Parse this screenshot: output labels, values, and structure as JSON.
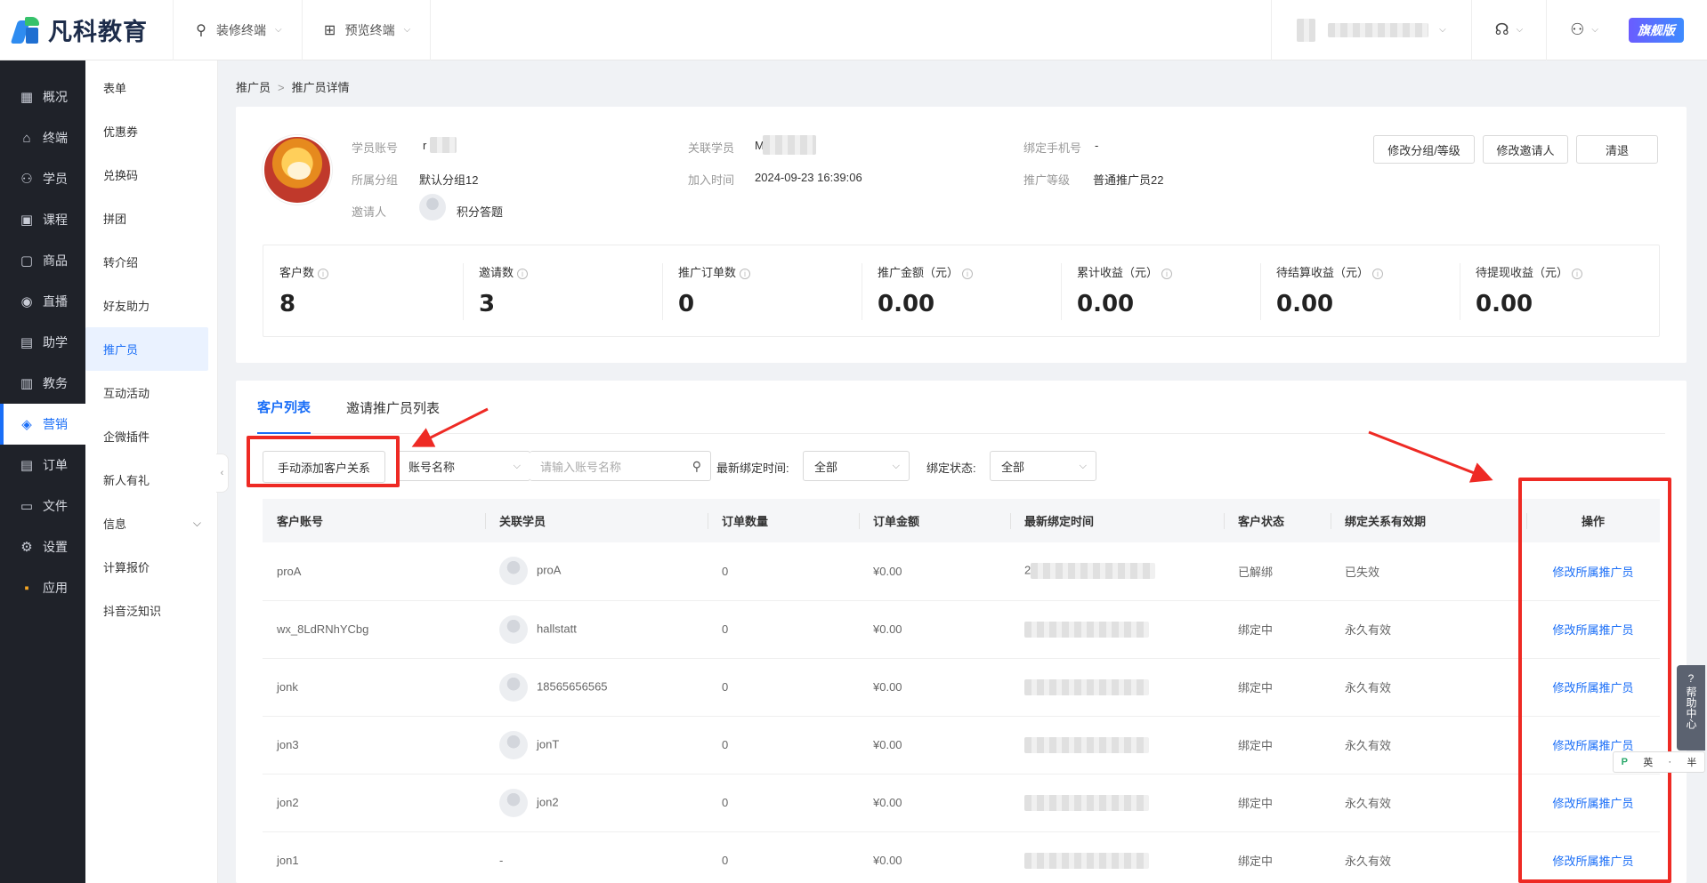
{
  "brand": {
    "name": "凡科教育"
  },
  "top_menu": [
    {
      "label": "装修终端",
      "icon": "brush-icon"
    },
    {
      "label": "预览终端",
      "icon": "grid-icon"
    }
  ],
  "top_right": {
    "edition_badge": "旗舰版"
  },
  "nav_primary": [
    {
      "label": "概况",
      "icon": "dashboard-icon"
    },
    {
      "label": "终端",
      "icon": "store-icon"
    },
    {
      "label": "学员",
      "icon": "user-icon"
    },
    {
      "label": "课程",
      "icon": "course-icon"
    },
    {
      "label": "商品",
      "icon": "bag-icon"
    },
    {
      "label": "直播",
      "icon": "live-icon"
    },
    {
      "label": "助学",
      "icon": "assist-icon"
    },
    {
      "label": "教务",
      "icon": "book-icon"
    },
    {
      "label": "营销",
      "icon": "marketing-icon",
      "active": true
    },
    {
      "label": "订单",
      "icon": "order-icon"
    },
    {
      "label": "文件",
      "icon": "folder-icon"
    },
    {
      "label": "设置",
      "icon": "gear-icon"
    },
    {
      "label": "应用",
      "icon": "apps-icon"
    }
  ],
  "nav_secondary": [
    "表单",
    "优惠券",
    "兑换码",
    "拼团",
    "转介绍",
    "好友助力",
    "推广员",
    "互动活动",
    "企微插件",
    "新人有礼",
    "信息",
    "计算报价",
    "抖音泛知识"
  ],
  "nav_secondary_active": "推广员",
  "breadcrumb": {
    "parent": "推广员",
    "sep": ">",
    "current": "推广员详情"
  },
  "profile": {
    "labels": {
      "account": "学员账号",
      "linked": "关联学员",
      "phone": "绑定手机号",
      "group": "所属分组",
      "join_time": "加入时间",
      "level": "推广等级",
      "inviter": "邀请人"
    },
    "values": {
      "account": "r",
      "linked": "M",
      "phone": "-",
      "group": "默认分组12",
      "join_time": "2024-09-23 16:39:06",
      "level": "普通推广员22",
      "inviter": "积分答题"
    },
    "buttons": {
      "edit_group": "修改分组/等级",
      "edit_inviter": "修改邀请人",
      "clear": "清退"
    }
  },
  "stats": [
    {
      "label": "客户数",
      "value": "8"
    },
    {
      "label": "邀请数",
      "value": "3"
    },
    {
      "label": "推广订单数",
      "value": "0"
    },
    {
      "label": "推广金额（元）",
      "value": "0.00"
    },
    {
      "label": "累计收益（元）",
      "value": "0.00"
    },
    {
      "label": "待结算收益（元）",
      "value": "0.00"
    },
    {
      "label": "待提现收益（元）",
      "value": "0.00"
    }
  ],
  "tabs": [
    {
      "label": "客户列表",
      "active": true
    },
    {
      "label": "邀请推广员列表"
    }
  ],
  "filters": {
    "add_button": "手动添加客户关系",
    "account_select": "账号名称",
    "search_placeholder": "请输入账号名称",
    "bind_time_label": "最新绑定时间:",
    "bind_time_value": "全部",
    "bind_status_label": "绑定状态:",
    "bind_status_value": "全部"
  },
  "table": {
    "headers": [
      "客户账号",
      "关联学员",
      "订单数量",
      "订单金额",
      "最新绑定时间",
      "客户状态",
      "绑定关系有效期",
      "操作"
    ],
    "rows": [
      {
        "account": "proA",
        "student": "proA",
        "orders": "0",
        "amount": "¥0.00",
        "time": "2",
        "status": "已解绑",
        "validity": "已失效",
        "action": "修改所属推广员"
      },
      {
        "account": "wx_8LdRNhYCbg",
        "student": "hallstatt",
        "orders": "0",
        "amount": "¥0.00",
        "time": "",
        "status": "绑定中",
        "validity": "永久有效",
        "action": "修改所属推广员"
      },
      {
        "account": "jonk",
        "student": "18565656565",
        "orders": "0",
        "amount": "¥0.00",
        "time": "",
        "status": "绑定中",
        "validity": "永久有效",
        "action": "修改所属推广员"
      },
      {
        "account": "jon3",
        "student": "jonT",
        "orders": "0",
        "amount": "¥0.00",
        "time": "",
        "status": "绑定中",
        "validity": "永久有效",
        "action": "修改所属推广员"
      },
      {
        "account": "jon2",
        "student": "jon2",
        "orders": "0",
        "amount": "¥0.00",
        "time": "",
        "status": "绑定中",
        "validity": "永久有效",
        "action": "修改所属推广员"
      },
      {
        "account": "jon1",
        "student": "-",
        "orders": "0",
        "amount": "¥0.00",
        "time": "",
        "status": "绑定中",
        "validity": "永久有效",
        "action": "修改所属推广员"
      }
    ]
  },
  "help": {
    "label": "帮助中心"
  },
  "ime": {
    "lang": "英",
    "width": "半"
  },
  "colors": {
    "accent": "#1a6ef7",
    "annotation_red": "#ee2a24",
    "nav_bg": "#1f2229"
  }
}
